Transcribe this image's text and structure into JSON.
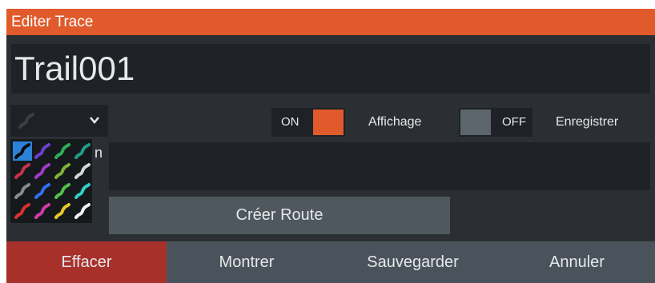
{
  "dialog": {
    "title": "Editer Trace",
    "name_value": "Trail001"
  },
  "colors": {
    "accent": "#e05a2b",
    "delete": "#a8302a",
    "palette_selected": "#2c82d6",
    "palette": [
      [
        "#3b8fe0",
        "#6a3fd1",
        "#2fae5a",
        "#1f9e8a"
      ],
      [
        "#c8324a",
        "#a03cc8",
        "#7fb23a",
        "#d6d6d6"
      ],
      [
        "#8a8a8a",
        "#2f6ff0",
        "#52c24a",
        "#2fd0c8"
      ],
      [
        "#d8322b",
        "#d23ca8",
        "#e8c82a",
        "#f2f2f2"
      ]
    ]
  },
  "line_style_select": {
    "icon": "trail-line-icon",
    "chevron": "chevron-down-icon"
  },
  "toggles": {
    "display": {
      "state": "ON",
      "label": "Affichage"
    },
    "record": {
      "state": "OFF",
      "label": "Enregistrer"
    }
  },
  "partial_label": "n",
  "buttons": {
    "create_route": "Créer Route",
    "delete": "Effacer",
    "show": "Montrer",
    "save": "Sauvegarder",
    "cancel": "Annuler"
  }
}
